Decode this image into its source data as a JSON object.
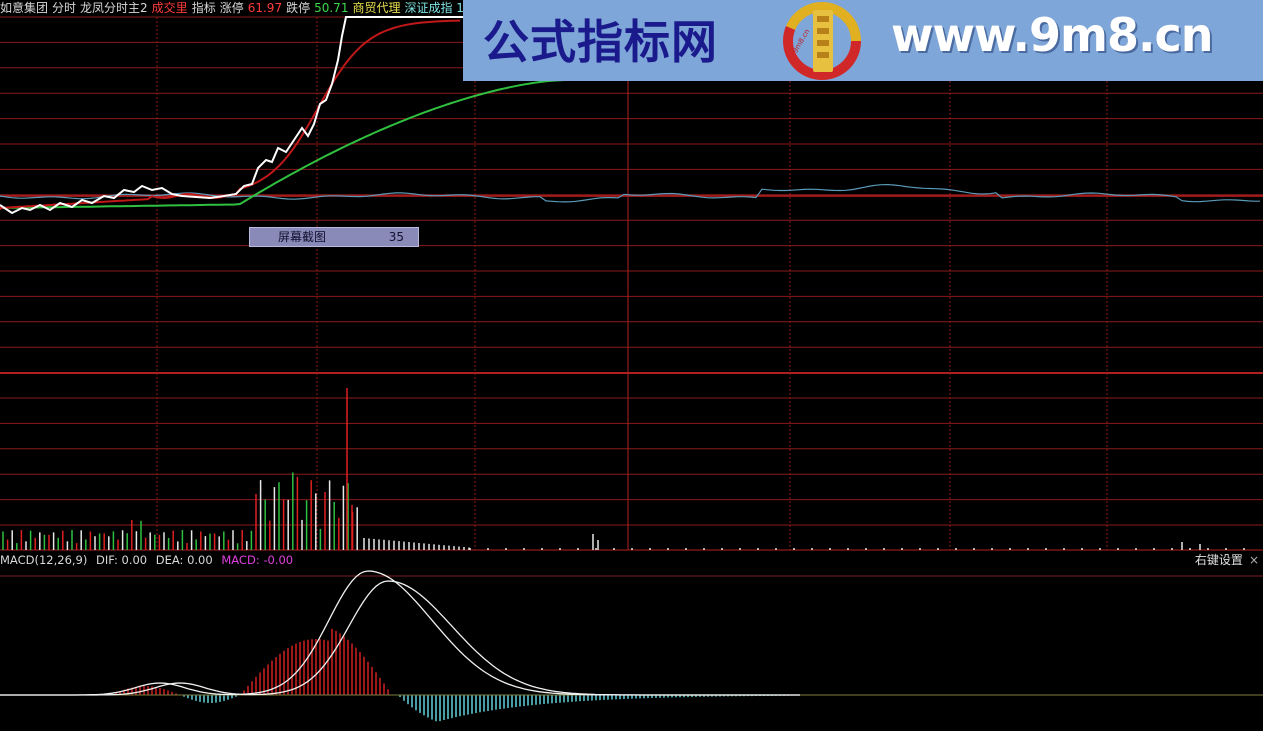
{
  "header": {
    "items": [
      {
        "text": "如意集团",
        "color": "white"
      },
      {
        "text": "分时",
        "color": "white"
      },
      {
        "text": "龙凤分时主2",
        "color": "white"
      },
      {
        "text": "成交里",
        "color": "red"
      },
      {
        "text": "指标",
        "color": "white"
      },
      {
        "text": "涨停",
        "color": "white"
      },
      {
        "text": "61.97",
        "color": "red"
      },
      {
        "text": "跌停",
        "color": "white"
      },
      {
        "text": "50.71",
        "color": "green"
      },
      {
        "text": "商贸代理",
        "color": "yellow"
      },
      {
        "text": "深证成指 1",
        "color": "cyan"
      }
    ]
  },
  "macd": {
    "name": "MACD(12,26,9)",
    "dif": "DIF: 0.00",
    "dea": "DEA: 0.00",
    "macd": "MACD: -0.00"
  },
  "right_button": {
    "label": "右键设置",
    "close": "×"
  },
  "popup": {
    "label": "屏幕截图",
    "value": "35"
  },
  "banner": {
    "title": "公式指标网",
    "url": "www.9m8.cn",
    "logo_text": "9m8.cn",
    "bg": "#7fa6d8",
    "title_color": "#1a1a8c"
  },
  "colors": {
    "grid": "#8c1a1a",
    "price_line": "#ffffff",
    "avg_red": "#c01818",
    "avg_green": "#30c040",
    "index_line": "#5a9ab8",
    "vol_red": "#e02020",
    "vol_green": "#30c040",
    "vol_white": "#e8e8e8",
    "macd_red": "#d02020",
    "macd_cyan": "#60d0d8"
  }
}
